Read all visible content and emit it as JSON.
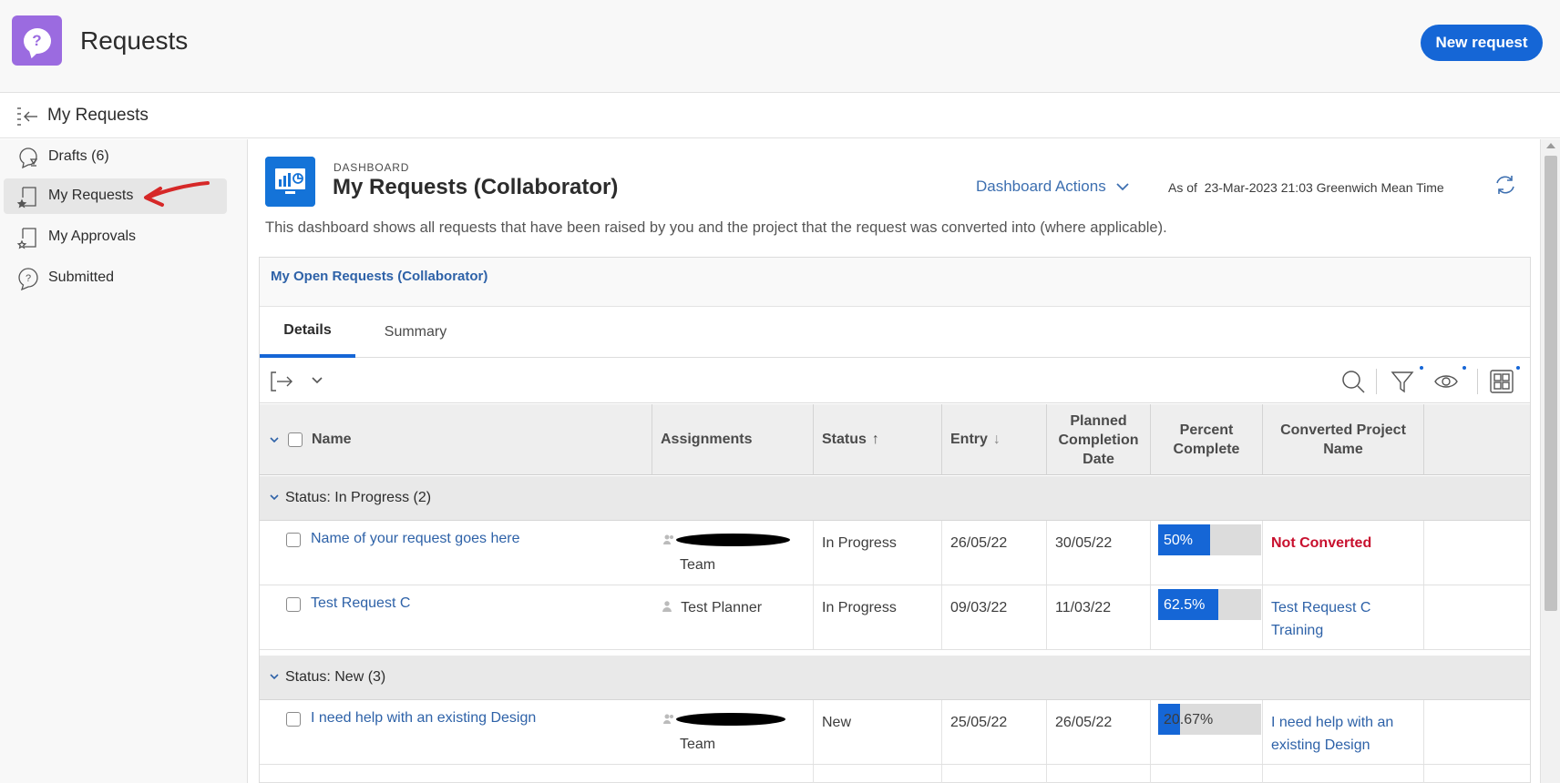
{
  "header": {
    "app_title": "Requests",
    "new_request_label": "New request",
    "app_icon_glyph": "?"
  },
  "subheader": {
    "title": "My Requests"
  },
  "sidebar": {
    "items": [
      {
        "label": "Drafts (6)",
        "icon": "drafts-icon"
      },
      {
        "label": "My Requests",
        "icon": "my-requests-icon",
        "active": true
      },
      {
        "label": "My Approvals",
        "icon": "approvals-icon"
      },
      {
        "label": "Submitted",
        "icon": "submitted-icon"
      }
    ]
  },
  "dashboard": {
    "eyebrow": "DASHBOARD",
    "title": "My Requests (Collaborator)",
    "actions_label": "Dashboard Actions",
    "as_of_label": "As of",
    "as_of_value": "23-Mar-2023 21:03 Greenwich Mean Time",
    "description": "This dashboard shows all requests that have been raised by you and the project that the request was converted into (where applicable)."
  },
  "panel": {
    "title": "My Open Requests (Collaborator)",
    "tabs": [
      "Details",
      "Summary"
    ]
  },
  "table": {
    "columns": {
      "name": "Name",
      "assignments": "Assignments",
      "status": "Status",
      "status_sort": "↑",
      "entry": "Entry",
      "entry_sort": "↓",
      "planned": "Planned Completion Date",
      "percent": "Percent Complete",
      "converted": "Converted Project Name"
    },
    "groups": [
      {
        "label": "Status: In Progress (2)",
        "rows": [
          {
            "name": "Name of your request goes here",
            "assignment_line2": "Team",
            "status": "In Progress",
            "entry": "26/05/22",
            "planned": "30/05/22",
            "percent_label": "50%",
            "percent": 50,
            "converted": "Not Converted",
            "converted_type": "not-converted"
          },
          {
            "name": "Test Request C",
            "assignment": "Test Planner",
            "status": "In Progress",
            "entry": "09/03/22",
            "planned": "11/03/22",
            "percent_label": "62.5%",
            "percent": 62.5,
            "converted": "Test Request C Training",
            "converted_type": "link"
          }
        ]
      },
      {
        "label": "Status: New (3)",
        "rows": [
          {
            "name": "I need help with an existing Design",
            "assignment_line2": "Team",
            "status": "New",
            "entry": "25/05/22",
            "planned": "26/05/22",
            "percent_label": "20.67%",
            "percent": 20.67,
            "converted": "I need help with an existing Design",
            "converted_type": "link"
          }
        ]
      }
    ]
  },
  "colors": {
    "accent": "#1566d6",
    "app_icon": "#9b6be0",
    "link": "#2e62a8",
    "not_converted": "#c8102e",
    "annotation_arrow": "#d62828"
  }
}
